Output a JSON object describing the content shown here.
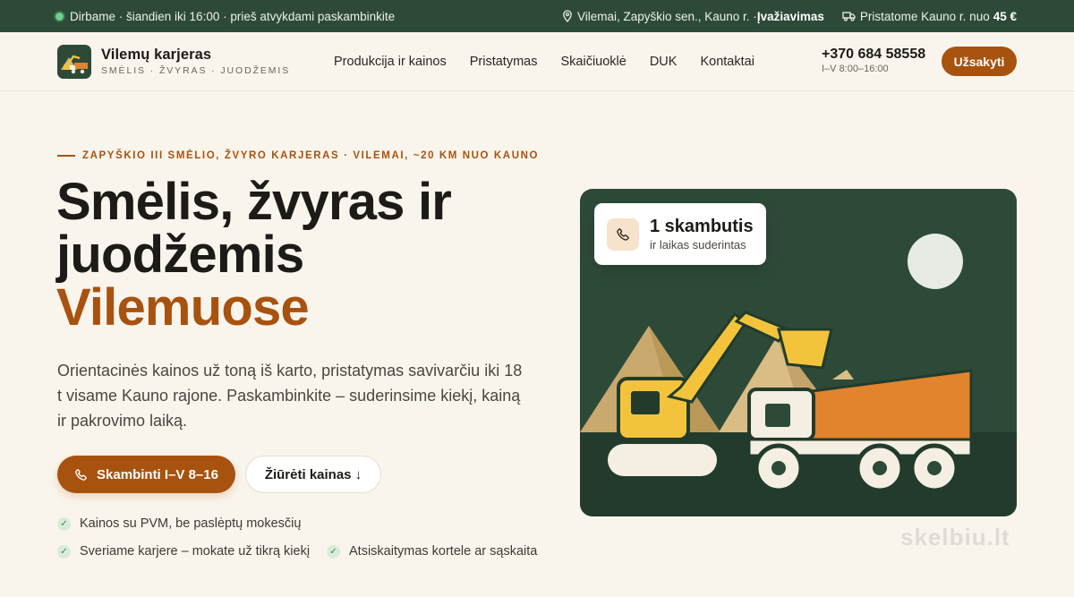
{
  "topbar": {
    "status": "Dirbame · šiandien iki 16:00 · prieš atvykdami paskambinkite",
    "location": "Vilemai, Zapyškio sen., Kauno r. · ",
    "entrance": "Įvažiavimas",
    "delivery_prefix": "Pristatome Kauno r. nuo ",
    "delivery_price": "45 €"
  },
  "brand": {
    "name": "Vilemų karjeras",
    "subtitle": "SMĖLIS · ŽVYRAS · JUODŽEMIS"
  },
  "nav": [
    "Produkcija ir kainos",
    "Pristatymas",
    "Skaičiuoklė",
    "DUK",
    "Kontaktai"
  ],
  "contact": {
    "phone": "+370 684 58558",
    "hours": "I–V 8:00–16:00"
  },
  "header": {
    "order_label": "Užsakyti"
  },
  "hero": {
    "eyebrow": "ZAPYŠKIO III SMĖLIO, ŽVYRO KARJERAS · VILEMAI, ~20 KM NUO KAUNO",
    "title_line1": "Smėlis, žvyras ir",
    "title_line2": "juodžemis",
    "title_accent": "Vilemuose",
    "lead": "Orientacinės kainos už toną iš karto, pristatymas savivarčiu iki 18 t visame Kauno rajone. Paskambinkite – suderinsime kiekį, kainą ir pakrovimo laiką.",
    "call_label": "Skambinti I–V 8–16",
    "prices_label": "Žiūrėti kainas ↓",
    "checks": [
      "Kainos su PVM, be paslėptų mokesčių",
      "Sveriame karjere – mokate už tikrą kiekį",
      "Atsiskaitymas kortele ar sąskaita"
    ]
  },
  "popup": {
    "title": "1 skambutis",
    "subtitle": "ir laikas suderintas"
  },
  "watermark": "skelbiu.lt",
  "colors": {
    "accent": "#a8520f",
    "dark_green": "#2d4a38",
    "background": "#faf5ec"
  },
  "icons": [
    "pin-icon",
    "truck-icon",
    "phone-icon",
    "check-icon",
    "excavator-illustration"
  ]
}
